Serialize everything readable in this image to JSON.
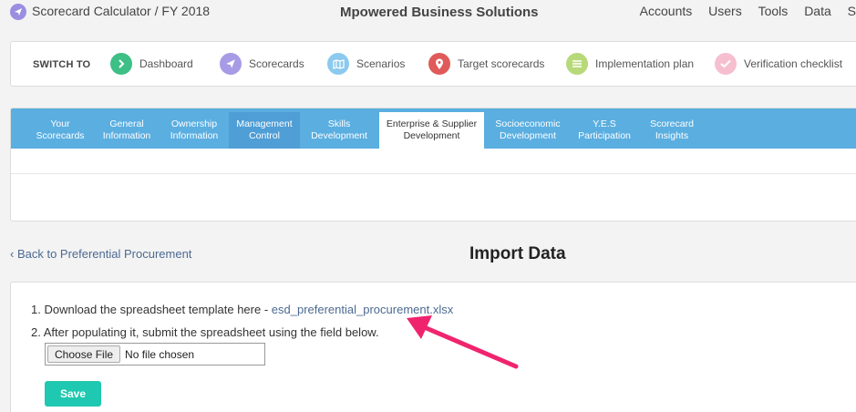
{
  "header": {
    "app_title": "Scorecard Calculator",
    "fiscal_year": "/ FY 2018",
    "company": "Mpowered Business Solutions",
    "nav": [
      "Accounts",
      "Users",
      "Tools",
      "Data",
      "S"
    ]
  },
  "switch_to": {
    "label": "SWITCH TO",
    "items": [
      {
        "label": "Dashboard",
        "icon": "chevron-right-icon",
        "color": "#3dbf86"
      },
      {
        "label": "Scorecards",
        "icon": "paper-plane-icon",
        "color": "#a79be6"
      },
      {
        "label": "Scenarios",
        "icon": "map-icon",
        "color": "#8cc9ef"
      },
      {
        "label": "Target scorecards",
        "icon": "location-pin-icon",
        "color": "#e05a5a"
      },
      {
        "label": "Implementation plan",
        "icon": "list-icon",
        "color": "#b8d97a"
      },
      {
        "label": "Verification checklist",
        "icon": "check-icon",
        "color": "#f6bfd0"
      }
    ]
  },
  "tabs": [
    {
      "label": "Your\nScorecards"
    },
    {
      "label": "General\nInformation"
    },
    {
      "label": "Ownership\nInformation"
    },
    {
      "label": "Management\nControl"
    },
    {
      "label": "Skills\nDevelopment"
    },
    {
      "label": "Enterprise & Supplier\nDevelopment"
    },
    {
      "label": "Socioeconomic\nDevelopment"
    },
    {
      "label": "Y.E.S\nParticipation"
    },
    {
      "label": "Scorecard\nInsights"
    }
  ],
  "page": {
    "back_link": "‹ Back to Preferential Procurement",
    "title": "Import Data",
    "step1_prefix": "1. Download the spreadsheet template here - ",
    "step1_link": "esd_preferential_procurement.xlsx",
    "step2": "2. After populating it, submit the spreadsheet using the field below.",
    "file_button": "Choose File",
    "file_status": "No file chosen",
    "save_label": "Save"
  },
  "colors": {
    "accent": "#5aaee0",
    "save": "#1fc8b0",
    "annotation_arrow": "#f0246e"
  }
}
